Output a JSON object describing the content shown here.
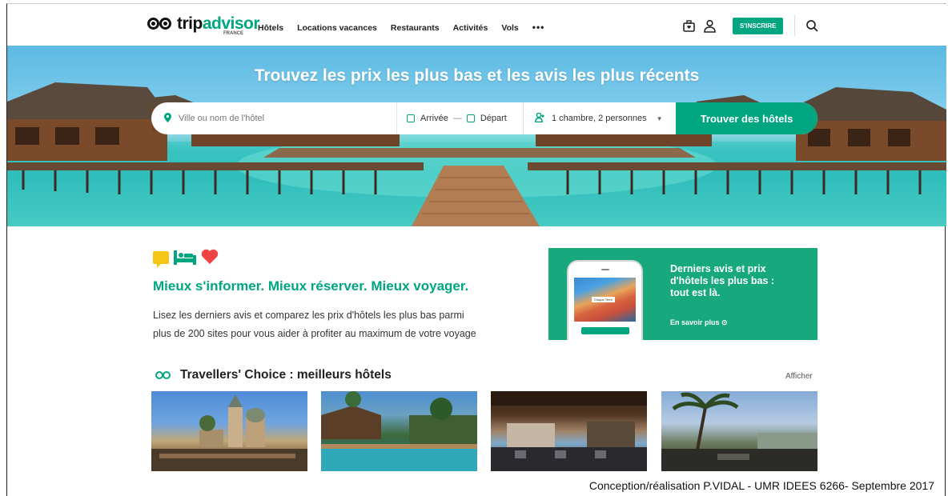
{
  "nav": {
    "logo_trip": "trip",
    "logo_advisor": "advisor",
    "logo_country": "FRANCE",
    "menu": [
      "Hôtels",
      "Locations vacances",
      "Restaurants",
      "Activités",
      "Vols",
      "•••"
    ],
    "signup": "S'INSCRIRE",
    "icons": [
      "suitcase-heart-icon",
      "user-icon",
      "search-icon"
    ]
  },
  "hero": {
    "title": "Trouvez les prix les plus bas et les avis les plus récents",
    "search_placeholder": "Ville ou nom de l'hôtel",
    "arrival": "Arrivée",
    "departure": "Départ",
    "date_sep": "—",
    "guests": "1 chambre, 2 personnes",
    "find_button": "Trouver des hôtels"
  },
  "features": {
    "icons": [
      "speech-bubble-icon",
      "bed-icon",
      "heart-icon"
    ],
    "tagline": "Mieux s'informer. Mieux réserver. Mieux voyager.",
    "desc_line1": "Lisez les derniers avis et comparez les prix d'hôtels les plus bas parmi",
    "desc_line2": "plus de 200 sites pour vous aider à profiter au maximum de votre voyage"
  },
  "promo": {
    "text_line1": "Derniers avis et prix",
    "text_line2": "d'hôtels les plus bas :",
    "text_line3": "tout est là.",
    "link": "En savoir plus ⊙",
    "phone_label": "Cinque Terre"
  },
  "travellers_choice": {
    "title": "Travellers' Choice : meilleurs hôtels",
    "more": "Afficher"
  },
  "credit": "Conception/réalisation P.VIDAL - UMR IDEES 6266- Septembre 2017",
  "colors": {
    "brand": "#00a680",
    "promo_bg": "#17a87d",
    "heart": "#ef4444",
    "bubble": "#f5c518"
  }
}
